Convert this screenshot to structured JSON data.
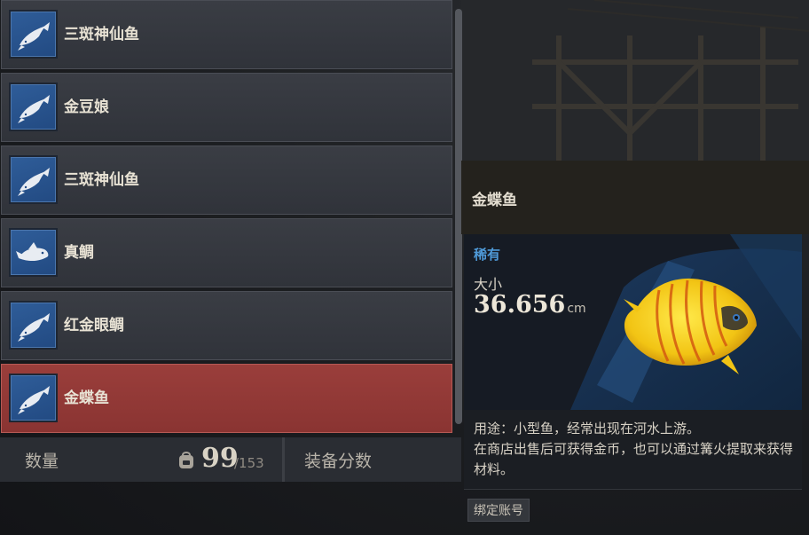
{
  "fish_list": {
    "items": [
      {
        "label": "三斑神仙鱼",
        "icon": "fish-icon",
        "selected": false
      },
      {
        "label": "金豆娘",
        "icon": "fish-icon",
        "selected": false
      },
      {
        "label": "三斑神仙鱼",
        "icon": "fish-icon",
        "selected": false
      },
      {
        "label": "真鲷",
        "icon": "fish-icon",
        "selected": false
      },
      {
        "label": "红金眼鲷",
        "icon": "fish-icon",
        "selected": false
      },
      {
        "label": "金蝶鱼",
        "icon": "fish-icon",
        "selected": true
      }
    ]
  },
  "footer": {
    "quantity_label": "数量",
    "quantity_value": "99",
    "quantity_max": "/153",
    "equip_score_label": "装备分数",
    "bag_icon": "backpack-icon"
  },
  "detail": {
    "title": "金蝶鱼",
    "rarity": "稀有",
    "size_label": "大小",
    "size_value": "36.656",
    "size_unit": "cm",
    "description_line1": "用途：小型鱼，经常出现在河水上游。",
    "description_line2": "在商店出售后可获得金币，也可以通过篝火提取来获得材料。",
    "bind_tag": "绑定账号"
  },
  "colors": {
    "selected_row": "#8a3432",
    "row": "#30333a",
    "icon_bg": "#2a5690",
    "rarity": "#4f9ad8"
  }
}
